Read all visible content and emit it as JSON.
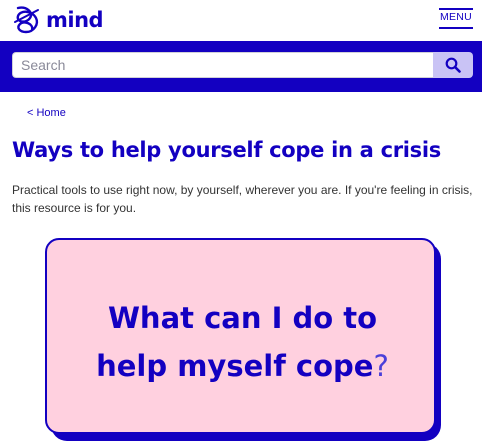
{
  "header": {
    "logo_text": "mind",
    "menu_label": "MENU"
  },
  "search": {
    "placeholder": "Search"
  },
  "breadcrumb": {
    "link": "< Home"
  },
  "page": {
    "title": "Ways to help yourself cope in a crisis",
    "intro": "Practical tools to use right now, by yourself, wherever you are. If you're feeling in crisis, this resource is for you."
  },
  "hero_card": {
    "line1": "What can I do to",
    "line2": "help myself cope",
    "qmark": "?"
  },
  "colors": {
    "brand": "#1300c1",
    "card_bg": "#ffd0df",
    "search_button": "#c9c3f5"
  },
  "icons": {
    "logo": "mind-logo-icon",
    "search": "search-icon",
    "menu": "menu-icon"
  }
}
